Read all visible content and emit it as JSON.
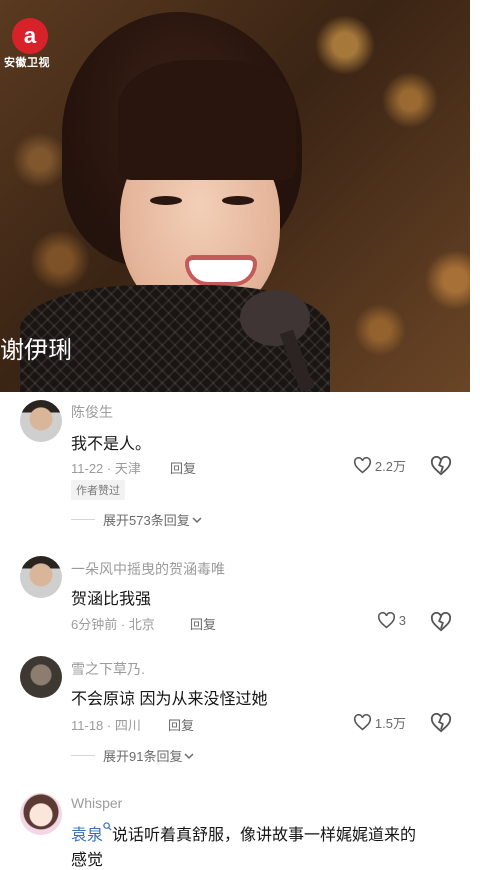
{
  "video": {
    "channel_logo_text": "安徽卫视",
    "caption": "谢伊琍"
  },
  "comments": [
    {
      "username": "陈俊生",
      "text": "我不是人。",
      "meta": "11-22 · 天津",
      "reply_label": "回复",
      "likes": "2.2万",
      "badge": "作者赞过",
      "expand_label": "展开573条回复"
    },
    {
      "username": "一朵风中摇曳的贺涵毒唯",
      "text": "贺涵比我强",
      "meta": "6分钟前 · 北京",
      "reply_label": "回复",
      "likes": "3"
    },
    {
      "username": "雪之下草乃.",
      "text": "不会原谅 因为从来没怪过她",
      "meta": "11-18 · 四川",
      "reply_label": "回复",
      "likes": "1.5万",
      "expand_label": "展开91条回复"
    },
    {
      "username": "Whisper",
      "mention": "袁泉",
      "text": "说话听着真舒服，像讲故事一样娓娓道来的",
      "text_line2": "感觉"
    }
  ],
  "icons": {
    "heart": "heart-outline-icon",
    "dislike": "broken-heart-icon",
    "expand": "chevron-down-icon",
    "search": "search-icon"
  },
  "colors": {
    "username": "#9b9b9b",
    "text": "#161616",
    "mention": "#3b6fb6",
    "logo": "#d8222a"
  }
}
